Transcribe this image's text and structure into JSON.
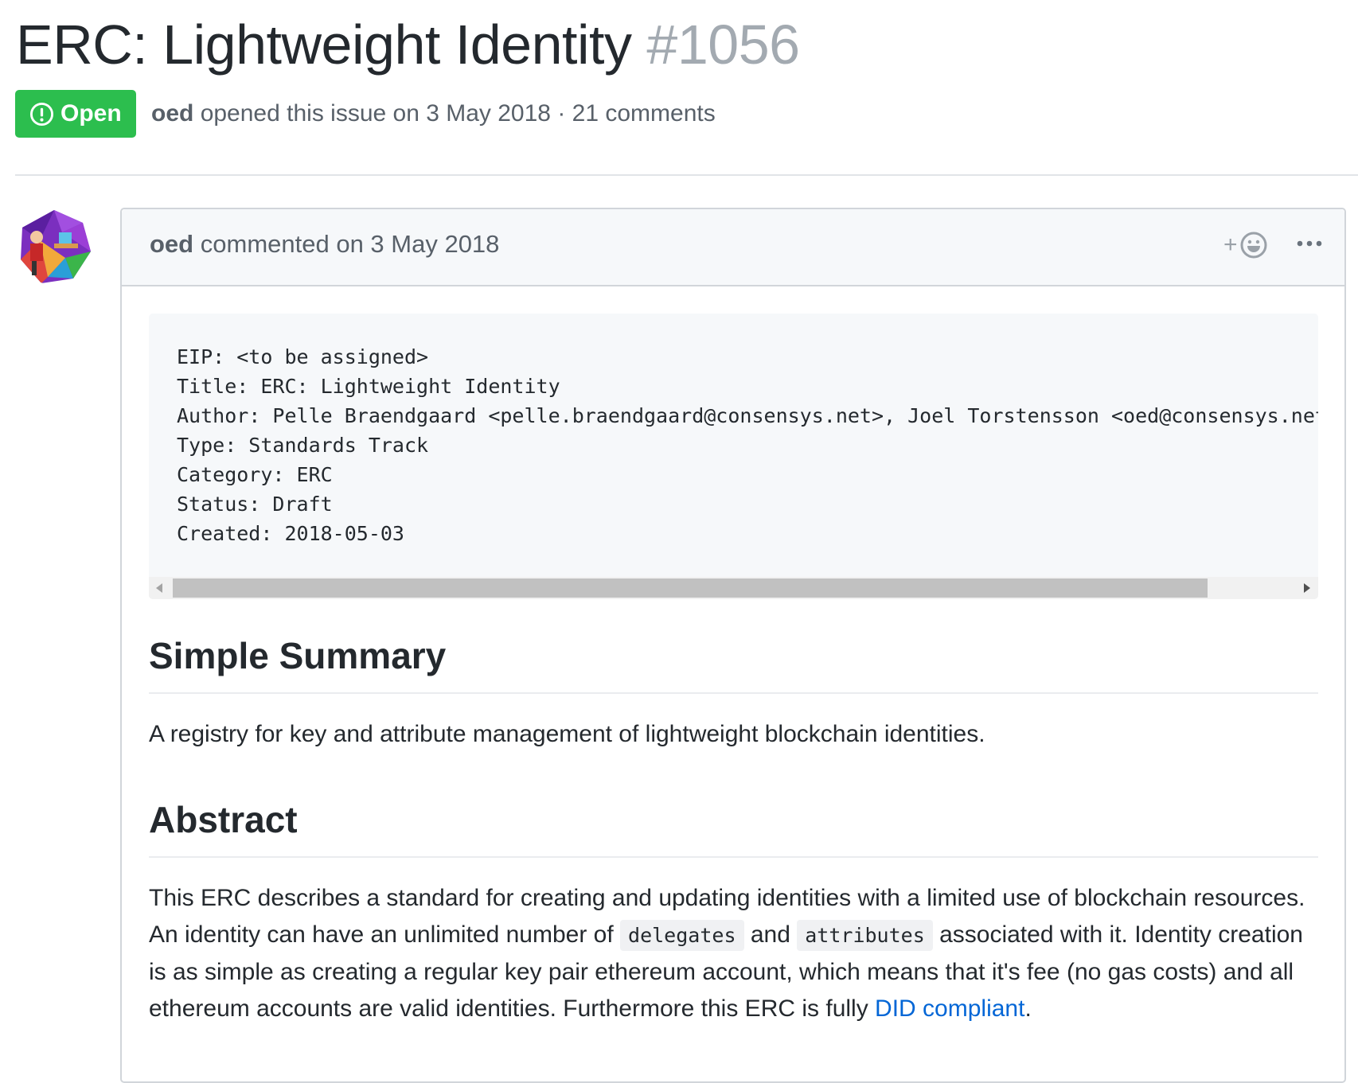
{
  "issue": {
    "title": "ERC: Lightweight Identity",
    "number": "#1056",
    "state": "Open",
    "author": "oed",
    "opened_text": "opened this issue on 3 May 2018 · 21 comments"
  },
  "comment": {
    "author": "oed",
    "commented_text": "commented on 3 May 2018",
    "reaction_plus": "+",
    "code_block": "EIP: <to be assigned>\nTitle: ERC: Lightweight Identity\nAuthor: Pelle Braendgaard <pelle.braendgaard@consensys.net>, Joel Torstensson <oed@consensys.net>\nType: Standards Track\nCategory: ERC\nStatus: Draft\nCreated: 2018-05-03",
    "summary_heading": "Simple Summary",
    "summary_text": "A registry for key and attribute management of lightweight blockchain identities.",
    "abstract_heading": "Abstract",
    "abstract": {
      "part1": "This ERC describes a standard for creating and updating identities with a limited use of blockchain resources. An identity can have an unlimited number of ",
      "code1": "delegates",
      "part2": " and ",
      "code2": "attributes",
      "part3": " associated with it. Identity creation is as simple as creating a regular key pair ethereum account, which means that it's fee (no gas costs) and all ethereum accounts are valid identities. Furthermore this ERC is fully ",
      "link_text": "DID compliant",
      "part4": "."
    }
  },
  "colors": {
    "open_badge": "#2cbe4e",
    "link": "#0366d6",
    "muted": "#586069"
  },
  "icons": [
    "issue-opened-icon",
    "add-reaction-icon",
    "kebab-horizontal-icon",
    "avatar"
  ]
}
